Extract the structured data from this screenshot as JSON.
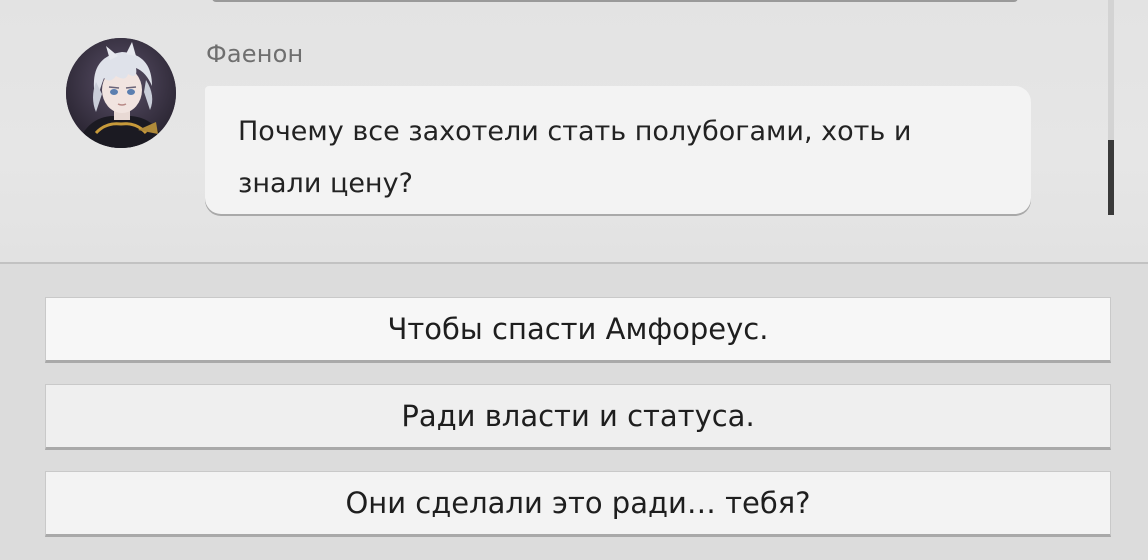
{
  "dialogue": {
    "speaker": {
      "name": "Фаенон",
      "avatar": "character-portrait"
    },
    "message": "Почему все захотели стать полубогами, хоть и знали цену?"
  },
  "choices": [
    {
      "label": "Чтобы спасти Амфореус."
    },
    {
      "label": "Ради власти и статуса."
    },
    {
      "label": "Они сделали это ради… тебя?"
    }
  ],
  "colors": {
    "bubble": "#f3f3f3",
    "choice": "#f5f5f5",
    "text": "#222222",
    "name": "#6f6f6f"
  }
}
